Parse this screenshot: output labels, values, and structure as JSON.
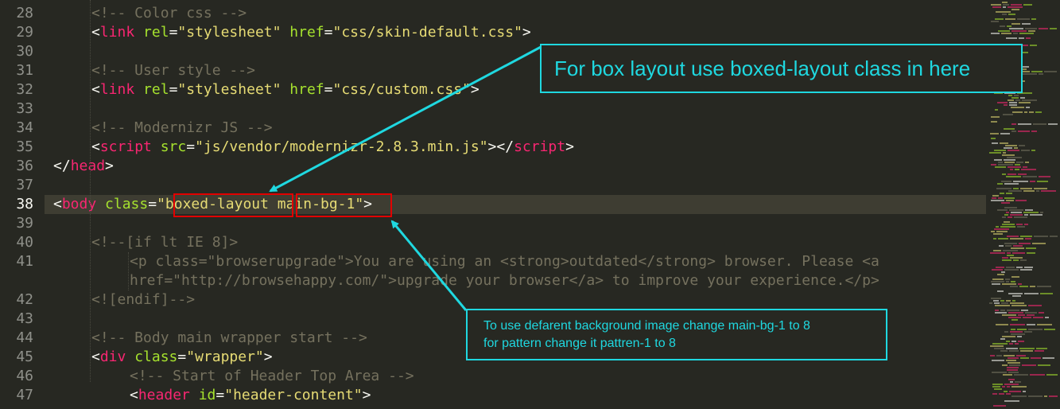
{
  "editor": {
    "current_line": "38",
    "lines": [
      {
        "n": "28",
        "t": [
          [
            "cm",
            "<!-- Color css -->"
          ]
        ]
      },
      {
        "n": "29",
        "t": [
          [
            "txt",
            "<"
          ],
          [
            "tag",
            "link"
          ],
          [
            "txt",
            " "
          ],
          [
            "attr",
            "rel"
          ],
          [
            "txt",
            "="
          ],
          [
            "str",
            "\"stylesheet\""
          ],
          [
            "txt",
            " "
          ],
          [
            "attr",
            "href"
          ],
          [
            "txt",
            "="
          ],
          [
            "str",
            "\"css/skin-default.css\""
          ],
          [
            "txt",
            ">"
          ]
        ]
      },
      {
        "n": "30",
        "t": []
      },
      {
        "n": "31",
        "t": [
          [
            "cm",
            "<!-- User style -->"
          ]
        ]
      },
      {
        "n": "32",
        "t": [
          [
            "txt",
            "<"
          ],
          [
            "tag",
            "link"
          ],
          [
            "txt",
            " "
          ],
          [
            "attr",
            "rel"
          ],
          [
            "txt",
            "="
          ],
          [
            "str",
            "\"stylesheet\""
          ],
          [
            "txt",
            " "
          ],
          [
            "attr",
            "href"
          ],
          [
            "txt",
            "="
          ],
          [
            "str",
            "\"css/custom.css\""
          ],
          [
            "txt",
            ">"
          ]
        ]
      },
      {
        "n": "33",
        "t": []
      },
      {
        "n": "34",
        "t": [
          [
            "cm",
            "<!-- Modernizr JS -->"
          ]
        ]
      },
      {
        "n": "35",
        "t": [
          [
            "txt",
            "<"
          ],
          [
            "tag",
            "script"
          ],
          [
            "txt",
            " "
          ],
          [
            "attr",
            "src"
          ],
          [
            "txt",
            "="
          ],
          [
            "str",
            "\"js/vendor/modernizr-2.8.3.min.js\""
          ],
          [
            "txt",
            "></"
          ],
          [
            "tag",
            "script"
          ],
          [
            "txt",
            ">"
          ]
        ]
      },
      {
        "n": "36",
        "t": [
          [
            "txt",
            "</"
          ],
          [
            "tag",
            "head"
          ],
          [
            "txt",
            ">"
          ]
        ]
      },
      {
        "n": "37",
        "t": []
      },
      {
        "n": "38",
        "t": [
          [
            "txt",
            "<"
          ],
          [
            "tag",
            "body"
          ],
          [
            "txt",
            " "
          ],
          [
            "attr",
            "class"
          ],
          [
            "txt",
            "="
          ],
          [
            "str",
            "\"boxed-layout main-bg-1\""
          ],
          [
            "txt",
            ">"
          ]
        ]
      },
      {
        "n": "39",
        "t": []
      },
      {
        "n": "40",
        "t": [
          [
            "cm",
            "<!--[if lt IE 8]>"
          ]
        ]
      },
      {
        "n": "41",
        "t": [
          [
            "cm",
            "<p class=\"browserupgrade\">You are using an <strong>outdated</strong> browser. Please <a"
          ]
        ]
      },
      {
        "n": "",
        "t": [
          [
            "cm",
            "href=\"http://browsehappy.com/\">upgrade your browser</a> to improve your experience.</p>"
          ]
        ]
      },
      {
        "n": "42",
        "t": [
          [
            "cm",
            "<![endif]-->"
          ]
        ]
      },
      {
        "n": "43",
        "t": []
      },
      {
        "n": "44",
        "t": [
          [
            "cm",
            "<!-- Body main wrapper start -->"
          ]
        ]
      },
      {
        "n": "45",
        "t": [
          [
            "txt",
            "<"
          ],
          [
            "tag",
            "div"
          ],
          [
            "txt",
            " "
          ],
          [
            "attr",
            "class"
          ],
          [
            "txt",
            "="
          ],
          [
            "str",
            "\"wrapper\""
          ],
          [
            "txt",
            ">"
          ]
        ]
      },
      {
        "n": "46",
        "t": [
          [
            "cm",
            "<!-- Start of Header Top Area -->"
          ]
        ]
      },
      {
        "n": "47",
        "t": [
          [
            "txt",
            "<"
          ],
          [
            "tag",
            "header"
          ],
          [
            "txt",
            " "
          ],
          [
            "attr",
            "id"
          ],
          [
            "txt",
            "="
          ],
          [
            "str",
            "\"header-content\""
          ],
          [
            "txt",
            ">"
          ]
        ]
      }
    ]
  },
  "annotations": {
    "box_layout": "For box layout use boxed-layout class in here",
    "background_line1": "To use defarent background image change main-bg-1 to 8",
    "background_line2": "for pattern change it pattren-1 to 8",
    "highlight_boxed_layout": "boxed-layout",
    "highlight_main_bg": "main-bg-1"
  },
  "colors": {
    "background": "#272822",
    "comment": "#75715E",
    "tag": "#F92672",
    "attribute": "#A6E22E",
    "string": "#E6DB74",
    "annotation": "#1FD8E0",
    "highlight": "#E20000"
  }
}
